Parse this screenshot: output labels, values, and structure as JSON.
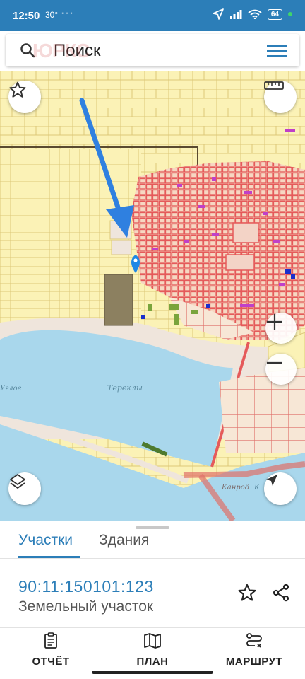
{
  "status_bar": {
    "time": "12:50",
    "temperature": "30°",
    "more": "···",
    "battery": "64"
  },
  "search": {
    "placeholder": "Поиск"
  },
  "watermark": "ЮРКС",
  "map": {
    "labels": {
      "lake": "Тереклы",
      "left_place": "Углое",
      "road_name": "Канрод",
      "bottom_right": "К"
    },
    "colors": {
      "parcel_fill": "#fbf2b6",
      "parcel_border": "#dcc878",
      "built_area": "#e55a5a",
      "water": "#a9d7ec",
      "beach": "#efe5dc",
      "arrow": "#2f80e0",
      "selected_parcel": "#8c8060",
      "buildings": "#c040c8"
    }
  },
  "sheet": {
    "tabs": [
      {
        "label": "Участки",
        "active": true
      },
      {
        "label": "Здания",
        "active": false
      }
    ],
    "cadastral_number": "90:11:150101:123",
    "parcel_type": "Земельный участок"
  },
  "bottom_nav": [
    {
      "label": "ОТЧЁТ",
      "icon": "report-icon"
    },
    {
      "label": "ПЛАН",
      "icon": "map-icon"
    },
    {
      "label": "МАРШРУТ",
      "icon": "route-icon"
    }
  ]
}
